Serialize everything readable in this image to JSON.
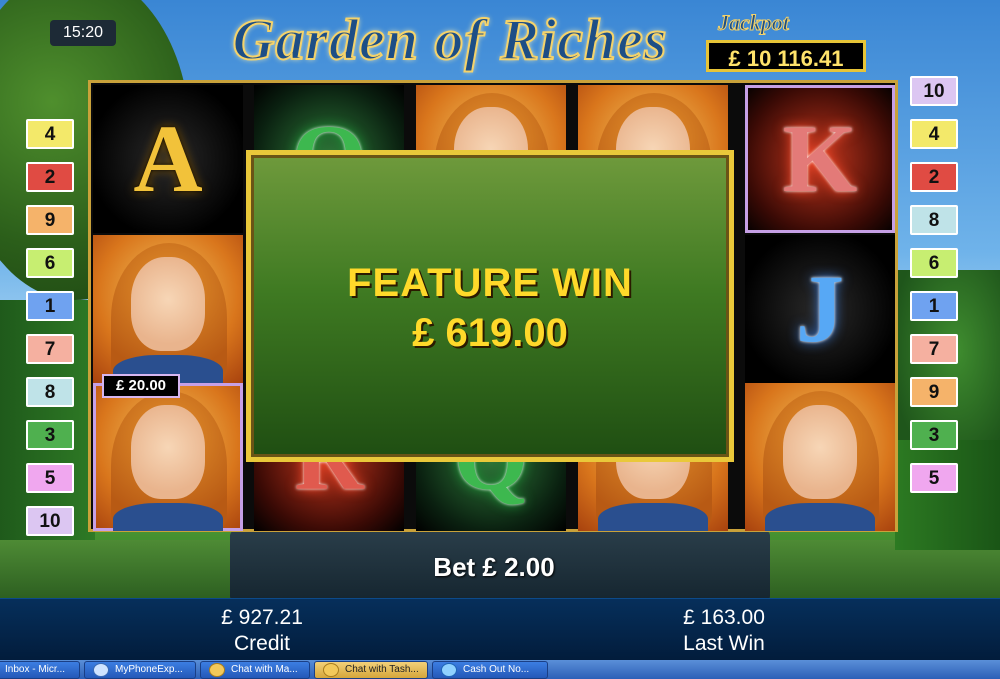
{
  "game": {
    "title": "Garden of Riches",
    "clock": "15:20",
    "jackpot_label": "Jackpot",
    "jackpot_value": "£ 10 116.41"
  },
  "paylines": {
    "left": [
      "4",
      "2",
      "9",
      "6",
      "1",
      "7",
      "8",
      "3",
      "5",
      "10"
    ],
    "right": [
      "10",
      "4",
      "2",
      "8",
      "6",
      "1",
      "7",
      "9",
      "3",
      "5"
    ]
  },
  "reels": {
    "symbols": [
      [
        "A",
        "lady",
        "lady"
      ],
      [
        "Q",
        "lady",
        "R"
      ],
      [
        "lady",
        "",
        "Q"
      ],
      [
        "lady",
        "",
        "lady"
      ],
      [
        "K",
        "J",
        "lady"
      ]
    ],
    "cell_win": "£ 20.00"
  },
  "feature_win": {
    "title": "FEATURE WIN",
    "amount": "£ 619.00"
  },
  "bet": "Bet £ 2.00",
  "status": {
    "credit_value": "£ 927.21",
    "credit_label": "Credit",
    "last_win_value": "£ 163.00",
    "last_win_label": "Last Win"
  },
  "taskbar": {
    "items": [
      "Inbox - Micr...",
      "MyPhoneExp...",
      "Chat with Ma...",
      "Chat with Tash...",
      "Cash Out No..."
    ]
  },
  "colors": {
    "gold": "#e9c83a",
    "popup_text": "#ffd92a",
    "status_bar": "#062f5b"
  }
}
